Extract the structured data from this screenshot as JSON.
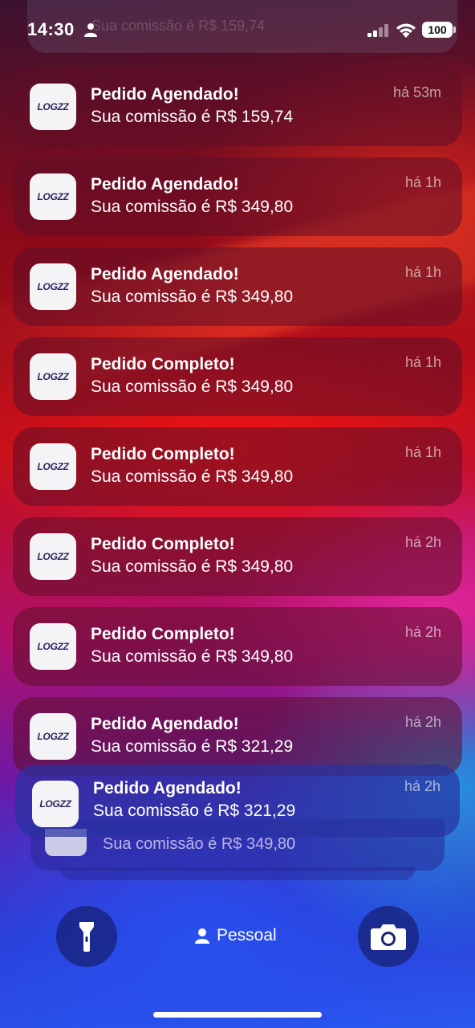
{
  "status_bar": {
    "time": "14:30",
    "battery": "100"
  },
  "ghost_top": {
    "text": "Sua comissão é R$ 159,74"
  },
  "notifications": [
    {
      "title": "Pedido Agendado!",
      "body": "Sua comissão é R$ 159,74",
      "time": "há 53m",
      "app_logo": "LOGZZ"
    },
    {
      "title": "Pedido Agendado!",
      "body": "Sua comissão é R$ 349,80",
      "time": "há 1h",
      "app_logo": "LOGZZ"
    },
    {
      "title": "Pedido Agendado!",
      "body": "Sua comissão é R$ 349,80",
      "time": "há 1h",
      "app_logo": "LOGZZ"
    },
    {
      "title": "Pedido Completo!",
      "body": "Sua comissão é R$ 349,80",
      "time": "há 1h",
      "app_logo": "LOGZZ"
    },
    {
      "title": "Pedido Completo!",
      "body": "Sua comissão é R$ 349,80",
      "time": "há 1h",
      "app_logo": "LOGZZ"
    },
    {
      "title": "Pedido Completo!",
      "body": "Sua comissão é R$ 349,80",
      "time": "há 2h",
      "app_logo": "LOGZZ"
    },
    {
      "title": "Pedido Completo!",
      "body": "Sua comissão é R$ 349,80",
      "time": "há 2h",
      "app_logo": "LOGZZ"
    },
    {
      "title": "Pedido Agendado!",
      "body": "Sua comissão é R$ 321,29",
      "time": "há 2h",
      "app_logo": "LOGZZ"
    },
    {
      "title": "Pedido Agendado!",
      "body": "Sua comissão é R$ 321,29",
      "time": "há 2h",
      "app_logo": "LOGZZ"
    }
  ],
  "stacked_notification": {
    "body": "Sua comissão é R$ 349,80"
  },
  "bottom": {
    "focus_label": "Pessoal",
    "flashlight_icon": "flashlight-icon",
    "camera_icon": "camera-icon"
  }
}
